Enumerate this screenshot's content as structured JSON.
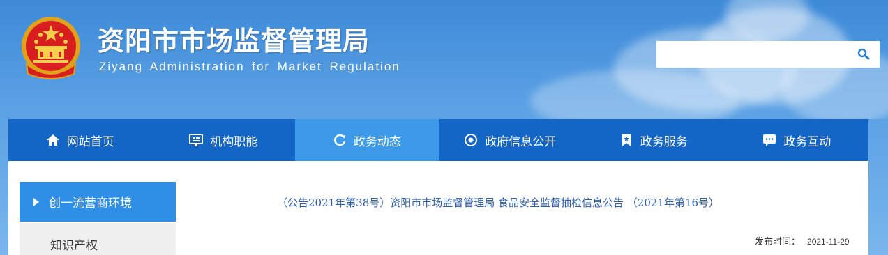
{
  "header": {
    "title": "资阳市市场监督管理局",
    "subtitle": "Ziyang  Administration for  Market Regulation",
    "emblem_icon": "national-emblem-icon"
  },
  "search": {
    "placeholder": "",
    "value": "",
    "icon": "search-icon"
  },
  "nav": {
    "items": [
      {
        "label": "网站首页",
        "icon": "home-icon"
      },
      {
        "label": "机构职能",
        "icon": "organization-icon"
      },
      {
        "label": "政务动态",
        "icon": "refresh-icon",
        "active": true
      },
      {
        "label": "政府信息公开",
        "icon": "info-circle-icon"
      },
      {
        "label": "政务服务",
        "icon": "bookmark-icon"
      },
      {
        "label": "政务互动",
        "icon": "chat-icon"
      }
    ]
  },
  "sidebar": {
    "items": [
      {
        "label": "创一流营商环境",
        "active": true
      },
      {
        "label": "知识产权"
      }
    ]
  },
  "article": {
    "title": "（公告2021年第38号）资阳市市场监督管理局  食品安全监督抽检信息公告  （2021年第16号）",
    "publish_label": "发布时间：",
    "publish_date": "2021-11-29"
  },
  "colors": {
    "nav_bg": "#1466c6",
    "nav_active": "#3d9ae8",
    "sidebar_active": "#2f8fe6",
    "title_link": "#2a5db0"
  }
}
